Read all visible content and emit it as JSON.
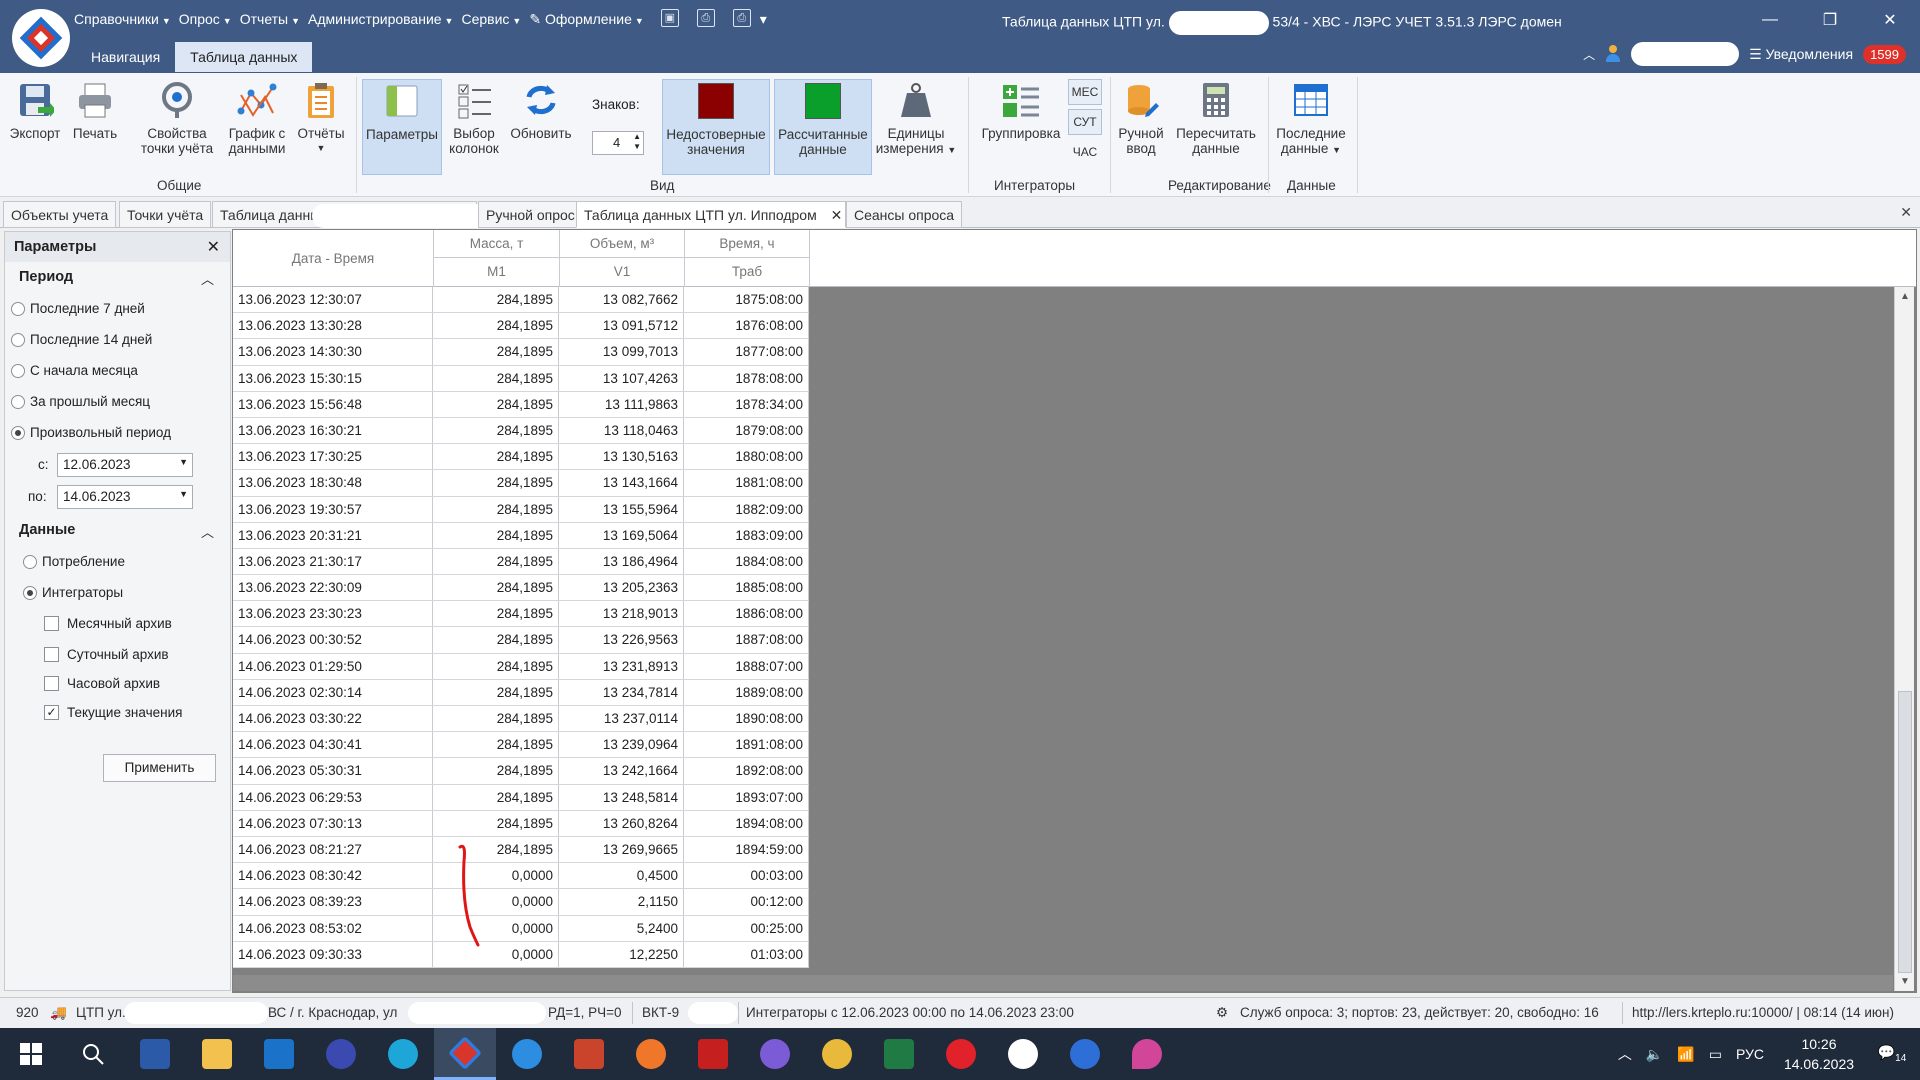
{
  "menu": {
    "items": [
      "Справочники",
      "Опрос",
      "Отчеты",
      "Администрирование",
      "Сервис",
      "Оформление"
    ]
  },
  "window": {
    "title_pre": "Таблица данных ЦТП ул.",
    "title_post": "53/4 - ХВС - ЛЭРС УЧЕТ 3.51.3 ЛЭРС домен"
  },
  "ribbon_tabs": [
    "Навигация",
    "Таблица данных"
  ],
  "notifications": {
    "label": "Уведомления",
    "count": "1599"
  },
  "ribbon": {
    "export": "Экспорт",
    "print": "Печать",
    "props_l1": "Свойства",
    "props_l2": "точки учёта",
    "graph_l1": "График с",
    "graph_l2": "данными",
    "reports": "Отчёты",
    "params": "Параметры",
    "colsel_l1": "Выбор",
    "colsel_l2": "колонок",
    "refresh": "Обновить",
    "digits_label": "Знаков:",
    "digits_value": "4",
    "invalid_l1": "Недостоверные",
    "invalid_l2": "значения",
    "calc_l1": "Рассчитанные",
    "calc_l2": "данные",
    "units_l1": "Единицы",
    "units_l2": "измерения",
    "grouping": "Группировка",
    "mes": "МЕС",
    "sut": "СУТ",
    "chas": "ЧАС",
    "manual_l1": "Ручной",
    "manual_l2": "ввод",
    "recalc_l1": "Пересчитать",
    "recalc_l2": "данные",
    "last_l1": "Последние",
    "last_l2": "данные",
    "groups": [
      "Общие",
      "Вид",
      "Интеграторы",
      "Редактирование",
      "Данные"
    ]
  },
  "doc_tabs": [
    "Объекты учета",
    "Точки учёта",
    "Таблица данных",
    "Ручной опрос",
    "Таблица данных ЦТП ул. Ипподром",
    "Сеансы опроса"
  ],
  "params": {
    "title": "Параметры",
    "period": "Период",
    "period_options": [
      "Последние 7 дней",
      "Последние 14 дней",
      "С начала месяца",
      "За прошлый месяц",
      "Произвольный период"
    ],
    "from_label": "с:",
    "from_value": "12.06.2023",
    "to_label": "по:",
    "to_value": "14.06.2023",
    "data": "Данные",
    "data_options": [
      "Потребление",
      "Интеграторы"
    ],
    "archives": [
      "Месячный архив",
      "Суточный архив",
      "Часовой архив",
      "Текущие значения"
    ],
    "apply": "Применить"
  },
  "table": {
    "headers": [
      {
        "title": "Дата - Время",
        "unit": ""
      },
      {
        "title": "Масса, т",
        "unit": "M1"
      },
      {
        "title": "Объем, м³",
        "unit": "V1"
      },
      {
        "title": "Время, ч",
        "unit": "Траб"
      }
    ],
    "rows": [
      [
        "13.06.2023 12:30:07",
        "284,1895",
        "13 082,7662",
        "1875:08:00"
      ],
      [
        "13.06.2023 13:30:28",
        "284,1895",
        "13 091,5712",
        "1876:08:00"
      ],
      [
        "13.06.2023 14:30:30",
        "284,1895",
        "13 099,7013",
        "1877:08:00"
      ],
      [
        "13.06.2023 15:30:15",
        "284,1895",
        "13 107,4263",
        "1878:08:00"
      ],
      [
        "13.06.2023 15:56:48",
        "284,1895",
        "13 111,9863",
        "1878:34:00"
      ],
      [
        "13.06.2023 16:30:21",
        "284,1895",
        "13 118,0463",
        "1879:08:00"
      ],
      [
        "13.06.2023 17:30:25",
        "284,1895",
        "13 130,5163",
        "1880:08:00"
      ],
      [
        "13.06.2023 18:30:48",
        "284,1895",
        "13 143,1664",
        "1881:08:00"
      ],
      [
        "13.06.2023 19:30:57",
        "284,1895",
        "13 155,5964",
        "1882:09:00"
      ],
      [
        "13.06.2023 20:31:21",
        "284,1895",
        "13 169,5064",
        "1883:09:00"
      ],
      [
        "13.06.2023 21:30:17",
        "284,1895",
        "13 186,4964",
        "1884:08:00"
      ],
      [
        "13.06.2023 22:30:09",
        "284,1895",
        "13 205,2363",
        "1885:08:00"
      ],
      [
        "13.06.2023 23:30:23",
        "284,1895",
        "13 218,9013",
        "1886:08:00"
      ],
      [
        "14.06.2023 00:30:52",
        "284,1895",
        "13 226,9563",
        "1887:08:00"
      ],
      [
        "14.06.2023 01:29:50",
        "284,1895",
        "13 231,8913",
        "1888:07:00"
      ],
      [
        "14.06.2023 02:30:14",
        "284,1895",
        "13 234,7814",
        "1889:08:00"
      ],
      [
        "14.06.2023 03:30:22",
        "284,1895",
        "13 237,0114",
        "1890:08:00"
      ],
      [
        "14.06.2023 04:30:41",
        "284,1895",
        "13 239,0964",
        "1891:08:00"
      ],
      [
        "14.06.2023 05:30:31",
        "284,1895",
        "13 242,1664",
        "1892:08:00"
      ],
      [
        "14.06.2023 06:29:53",
        "284,1895",
        "13 248,5814",
        "1893:07:00"
      ],
      [
        "14.06.2023 07:30:13",
        "284,1895",
        "13 260,8264",
        "1894:08:00"
      ],
      [
        "14.06.2023 08:21:27",
        "284,1895",
        "13 269,9665",
        "1894:59:00"
      ],
      [
        "14.06.2023 08:30:42",
        "0,0000",
        "0,4500",
        "00:03:00"
      ],
      [
        "14.06.2023 08:39:23",
        "0,0000",
        "2,1150",
        "00:12:00"
      ],
      [
        "14.06.2023 08:53:02",
        "0,0000",
        "5,2400",
        "00:25:00"
      ],
      [
        "14.06.2023 09:30:33",
        "0,0000",
        "12,2250",
        "01:03:00"
      ]
    ]
  },
  "status": {
    "count": "920",
    "ctp": "ЦТП ул.",
    "city": "ВС / г. Краснодар, ул",
    "rd": "РД=1, РЧ=0",
    "vkt": "ВКТ-9",
    "integrators": "Интеграторы с 12.06.2023 00:00 по 14.06.2023 23:00",
    "services": "Служб опроса: 3; портов: 23, действует: 20, свободно: 16",
    "server": "http://lers.krteplo.ru:10000/ | 08:14 (14 июн)"
  },
  "tray": {
    "lang": "РУС",
    "time": "10:26",
    "date": "14.06.2023",
    "msgs": "14"
  },
  "colors": {
    "titlebar": "#3e5a85",
    "invalid": "#8b0000",
    "calc": "#0a9e2a",
    "accent": "#1e6fd0",
    "badge": "#e0302a"
  }
}
